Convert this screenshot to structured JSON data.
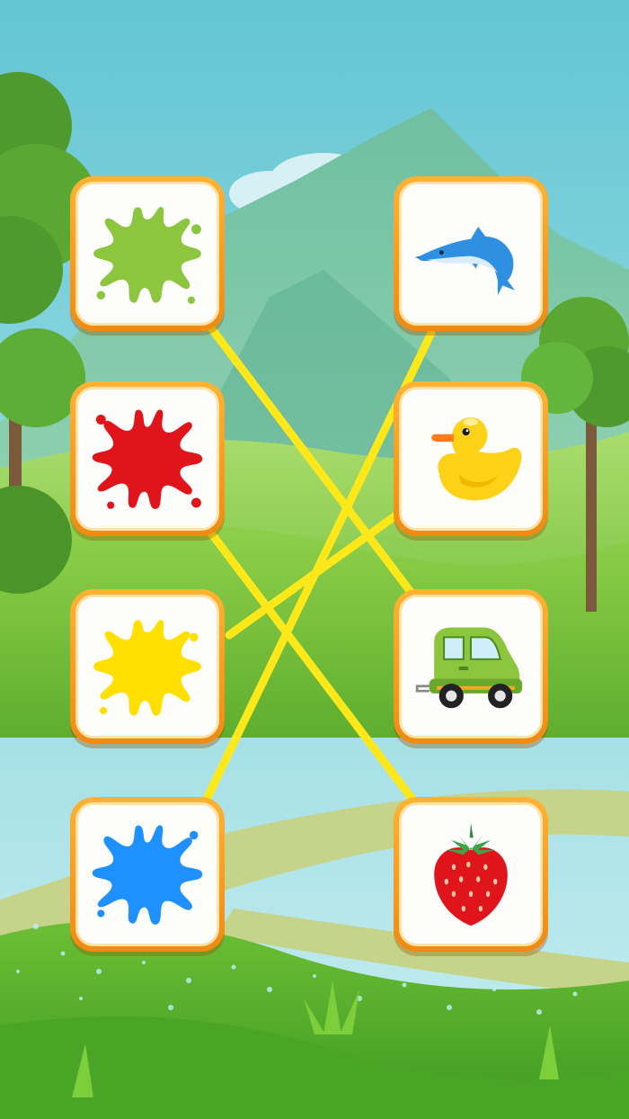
{
  "game": {
    "left_column": [
      {
        "id": "splash-green",
        "icon": "paint-splash-icon",
        "color": "#8cc63f"
      },
      {
        "id": "splash-red",
        "icon": "paint-splash-icon",
        "color": "#e0141b"
      },
      {
        "id": "splash-yellow",
        "icon": "paint-splash-icon",
        "color": "#ffe000"
      },
      {
        "id": "splash-blue",
        "icon": "paint-splash-icon",
        "color": "#1e90ff"
      }
    ],
    "right_column": [
      {
        "id": "dolphin",
        "icon": "dolphin-icon",
        "color": "#2f8fe0"
      },
      {
        "id": "duck",
        "icon": "rubber-duck-icon",
        "color": "#ffd21a"
      },
      {
        "id": "car",
        "icon": "car-icon",
        "color": "#8cc63f"
      },
      {
        "id": "strawberry",
        "icon": "strawberry-icon",
        "color": "#e0141b"
      }
    ],
    "connections": [
      {
        "from": "splash-green",
        "to": "car"
      },
      {
        "from": "splash-red",
        "to": "strawberry"
      },
      {
        "from": "splash-yellow",
        "to": "duck"
      },
      {
        "from": "splash-blue",
        "to": "dolphin"
      }
    ],
    "line_color": "#ffe81a"
  }
}
